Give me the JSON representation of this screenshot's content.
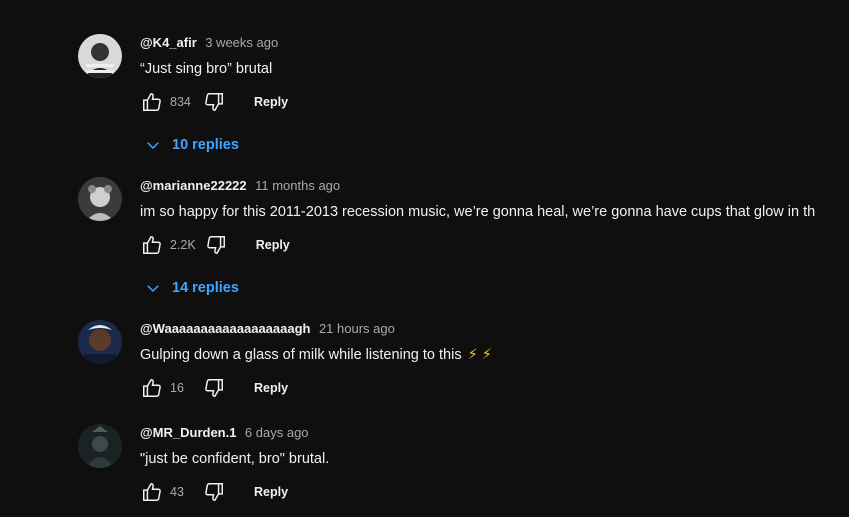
{
  "comments": [
    {
      "author": "@K4_afir",
      "time": "3 weeks ago",
      "text": "“Just sing bro” brutal",
      "likes": "834",
      "reply_label": "Reply",
      "replies_label": "10 replies",
      "avatar_icon": "avatar-photo"
    },
    {
      "author": "@marianne22222",
      "time": "11 months ago",
      "text": "im so happy for this 2011-2013 recession music, we’re gonna heal, we’re gonna have cups that glow in th",
      "likes": "2.2K",
      "reply_label": "Reply",
      "replies_label": "14 replies",
      "avatar_icon": "avatar-photo"
    },
    {
      "author": "@Waaaaaaaaaaaaaaaaaagh",
      "time": "21 hours ago",
      "text": "Gulping down a glass of milk while listening to this",
      "emoji": "⚡ ⚡",
      "likes": "16",
      "reply_label": "Reply",
      "avatar_icon": "avatar-photo"
    },
    {
      "author": "@MR_Durden.1",
      "time": "6 days ago",
      "text": "\"just be confident, bro\" brutal.",
      "likes": "43",
      "reply_label": "Reply",
      "avatar_icon": "avatar-photo"
    }
  ],
  "colors": {
    "background": "#0f0f0f",
    "link_blue": "#3ea6ff",
    "muted": "#aaaaaa"
  }
}
